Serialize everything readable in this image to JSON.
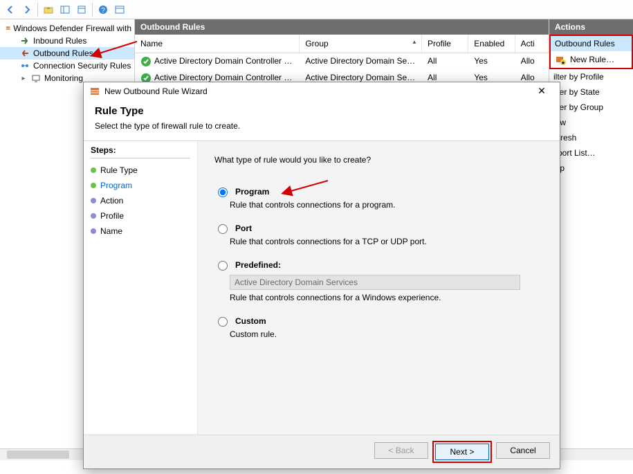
{
  "toolbar": {
    "icons": [
      "back-icon",
      "forward-icon",
      "up-icon",
      "show-hide-tree-icon",
      "properties-icon",
      "help-icon",
      "export-icon"
    ]
  },
  "tree": {
    "root": "Windows Defender Firewall with",
    "items": [
      {
        "label": "Inbound Rules"
      },
      {
        "label": "Outbound Rules",
        "selected": true
      },
      {
        "label": "Connection Security Rules"
      },
      {
        "label": "Monitoring",
        "expandable": true
      }
    ]
  },
  "center": {
    "header": "Outbound Rules",
    "columns": {
      "name": "Name",
      "group": "Group",
      "profile": "Profile",
      "enabled": "Enabled",
      "action": "Acti"
    },
    "rows": [
      {
        "name": "Active Directory Domain Controller -  Ec…",
        "group": "Active Directory Domain Ser…",
        "profile": "All",
        "enabled": "Yes",
        "action": "Allo"
      },
      {
        "name": "Active Directory Domain Controller -  Ec…",
        "group": "Active Directory Domain Ser…",
        "profile": "All",
        "enabled": "Yes",
        "action": "Allo"
      }
    ]
  },
  "actions": {
    "header": "Actions",
    "group_title": "Outbound Rules",
    "items": [
      {
        "label": "New Rule…",
        "icon": "new-rule-icon"
      },
      {
        "label": "ilter by Profile",
        "icon": "filter-icon"
      },
      {
        "label": "ilter by State",
        "icon": "filter-icon"
      },
      {
        "label": "ilter by Group",
        "icon": "filter-icon"
      },
      {
        "label": "iew",
        "icon": "view-icon"
      },
      {
        "label": "efresh",
        "icon": "refresh-icon"
      },
      {
        "label": "xport List…",
        "icon": "export-icon"
      },
      {
        "label": "elp",
        "icon": "help-icon"
      }
    ]
  },
  "dialog": {
    "title": "New Outbound Rule Wizard",
    "heading": "Rule Type",
    "subheading": "Select the type of firewall rule to create.",
    "steps_label": "Steps:",
    "steps": [
      {
        "label": "Rule Type",
        "state": "done"
      },
      {
        "label": "Program",
        "state": "done",
        "active": true
      },
      {
        "label": "Action",
        "state": "pending"
      },
      {
        "label": "Profile",
        "state": "pending"
      },
      {
        "label": "Name",
        "state": "pending"
      }
    ],
    "question": "What type of rule would you like to create?",
    "options": [
      {
        "key": "program",
        "label": "Program",
        "desc": "Rule that controls connections for a program.",
        "selected": true
      },
      {
        "key": "port",
        "label": "Port",
        "desc": "Rule that controls connections for a TCP or UDP port."
      },
      {
        "key": "predefined",
        "label": "Predefined:",
        "desc": "Rule that controls connections for a Windows experience.",
        "select_value": "Active Directory Domain Services"
      },
      {
        "key": "custom",
        "label": "Custom",
        "desc": "Custom rule."
      }
    ],
    "buttons": {
      "back": "< Back",
      "next": "Next >",
      "cancel": "Cancel"
    }
  }
}
